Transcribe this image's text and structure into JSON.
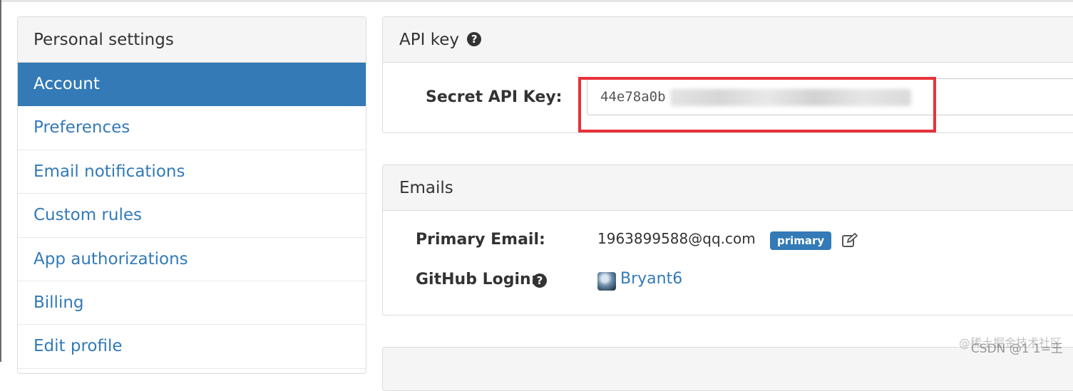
{
  "sidebar": {
    "title": "Personal settings",
    "items": [
      {
        "label": "Account",
        "active": true
      },
      {
        "label": "Preferences"
      },
      {
        "label": "Email notifications"
      },
      {
        "label": "Custom rules"
      },
      {
        "label": "App authorizations"
      },
      {
        "label": "Billing"
      },
      {
        "label": "Edit profile"
      }
    ]
  },
  "api_key_panel": {
    "title": "API key",
    "help_icon": "?",
    "field_label": "Secret API Key:",
    "field_value": "44e78a0b"
  },
  "emails_panel": {
    "title": "Emails",
    "primary_label": "Primary Email:",
    "primary_value": "1963899588@qq.com",
    "primary_badge": "primary",
    "github_label": "GitHub Login:",
    "help_icon": "?",
    "github_user": "Bryant6"
  },
  "watermark": {
    "line1": "@稀土掘金技术社区",
    "line2": "CSDN @1 1=王"
  },
  "colors": {
    "accent": "#337ab7",
    "highlight_box": "#e8313a"
  }
}
